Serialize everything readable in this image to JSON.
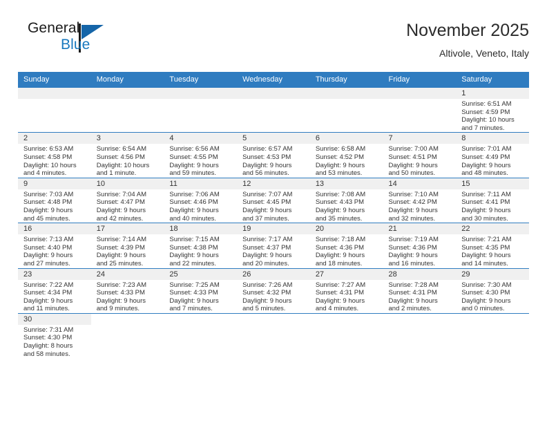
{
  "brand": {
    "name_part1": "General",
    "name_part2": "Blue"
  },
  "header": {
    "title": "November 2025",
    "location": "Altivole, Veneto, Italy"
  },
  "weekdays": [
    "Sunday",
    "Monday",
    "Tuesday",
    "Wednesday",
    "Thursday",
    "Friday",
    "Saturday"
  ],
  "colors": {
    "header_blue": "#2f7cc0",
    "brand_blue": "#1878be",
    "daynum_band": "#f0f0f0",
    "text": "#333333"
  },
  "weeks": [
    [
      {
        "type": "blank"
      },
      {
        "type": "blank"
      },
      {
        "type": "blank"
      },
      {
        "type": "blank"
      },
      {
        "type": "blank"
      },
      {
        "type": "blank"
      },
      {
        "type": "day",
        "day": "1",
        "sunrise": "Sunrise: 6:51 AM",
        "sunset": "Sunset: 4:59 PM",
        "daylight1": "Daylight: 10 hours",
        "daylight2": "and 7 minutes."
      }
    ],
    [
      {
        "type": "day",
        "day": "2",
        "sunrise": "Sunrise: 6:53 AM",
        "sunset": "Sunset: 4:58 PM",
        "daylight1": "Daylight: 10 hours",
        "daylight2": "and 4 minutes."
      },
      {
        "type": "day",
        "day": "3",
        "sunrise": "Sunrise: 6:54 AM",
        "sunset": "Sunset: 4:56 PM",
        "daylight1": "Daylight: 10 hours",
        "daylight2": "and 1 minute."
      },
      {
        "type": "day",
        "day": "4",
        "sunrise": "Sunrise: 6:56 AM",
        "sunset": "Sunset: 4:55 PM",
        "daylight1": "Daylight: 9 hours",
        "daylight2": "and 59 minutes."
      },
      {
        "type": "day",
        "day": "5",
        "sunrise": "Sunrise: 6:57 AM",
        "sunset": "Sunset: 4:53 PM",
        "daylight1": "Daylight: 9 hours",
        "daylight2": "and 56 minutes."
      },
      {
        "type": "day",
        "day": "6",
        "sunrise": "Sunrise: 6:58 AM",
        "sunset": "Sunset: 4:52 PM",
        "daylight1": "Daylight: 9 hours",
        "daylight2": "and 53 minutes."
      },
      {
        "type": "day",
        "day": "7",
        "sunrise": "Sunrise: 7:00 AM",
        "sunset": "Sunset: 4:51 PM",
        "daylight1": "Daylight: 9 hours",
        "daylight2": "and 50 minutes."
      },
      {
        "type": "day",
        "day": "8",
        "sunrise": "Sunrise: 7:01 AM",
        "sunset": "Sunset: 4:49 PM",
        "daylight1": "Daylight: 9 hours",
        "daylight2": "and 48 minutes."
      }
    ],
    [
      {
        "type": "day",
        "day": "9",
        "sunrise": "Sunrise: 7:03 AM",
        "sunset": "Sunset: 4:48 PM",
        "daylight1": "Daylight: 9 hours",
        "daylight2": "and 45 minutes."
      },
      {
        "type": "day",
        "day": "10",
        "sunrise": "Sunrise: 7:04 AM",
        "sunset": "Sunset: 4:47 PM",
        "daylight1": "Daylight: 9 hours",
        "daylight2": "and 42 minutes."
      },
      {
        "type": "day",
        "day": "11",
        "sunrise": "Sunrise: 7:06 AM",
        "sunset": "Sunset: 4:46 PM",
        "daylight1": "Daylight: 9 hours",
        "daylight2": "and 40 minutes."
      },
      {
        "type": "day",
        "day": "12",
        "sunrise": "Sunrise: 7:07 AM",
        "sunset": "Sunset: 4:45 PM",
        "daylight1": "Daylight: 9 hours",
        "daylight2": "and 37 minutes."
      },
      {
        "type": "day",
        "day": "13",
        "sunrise": "Sunrise: 7:08 AM",
        "sunset": "Sunset: 4:43 PM",
        "daylight1": "Daylight: 9 hours",
        "daylight2": "and 35 minutes."
      },
      {
        "type": "day",
        "day": "14",
        "sunrise": "Sunrise: 7:10 AM",
        "sunset": "Sunset: 4:42 PM",
        "daylight1": "Daylight: 9 hours",
        "daylight2": "and 32 minutes."
      },
      {
        "type": "day",
        "day": "15",
        "sunrise": "Sunrise: 7:11 AM",
        "sunset": "Sunset: 4:41 PM",
        "daylight1": "Daylight: 9 hours",
        "daylight2": "and 30 minutes."
      }
    ],
    [
      {
        "type": "day",
        "day": "16",
        "sunrise": "Sunrise: 7:13 AM",
        "sunset": "Sunset: 4:40 PM",
        "daylight1": "Daylight: 9 hours",
        "daylight2": "and 27 minutes."
      },
      {
        "type": "day",
        "day": "17",
        "sunrise": "Sunrise: 7:14 AM",
        "sunset": "Sunset: 4:39 PM",
        "daylight1": "Daylight: 9 hours",
        "daylight2": "and 25 minutes."
      },
      {
        "type": "day",
        "day": "18",
        "sunrise": "Sunrise: 7:15 AM",
        "sunset": "Sunset: 4:38 PM",
        "daylight1": "Daylight: 9 hours",
        "daylight2": "and 22 minutes."
      },
      {
        "type": "day",
        "day": "19",
        "sunrise": "Sunrise: 7:17 AM",
        "sunset": "Sunset: 4:37 PM",
        "daylight1": "Daylight: 9 hours",
        "daylight2": "and 20 minutes."
      },
      {
        "type": "day",
        "day": "20",
        "sunrise": "Sunrise: 7:18 AM",
        "sunset": "Sunset: 4:36 PM",
        "daylight1": "Daylight: 9 hours",
        "daylight2": "and 18 minutes."
      },
      {
        "type": "day",
        "day": "21",
        "sunrise": "Sunrise: 7:19 AM",
        "sunset": "Sunset: 4:36 PM",
        "daylight1": "Daylight: 9 hours",
        "daylight2": "and 16 minutes."
      },
      {
        "type": "day",
        "day": "22",
        "sunrise": "Sunrise: 7:21 AM",
        "sunset": "Sunset: 4:35 PM",
        "daylight1": "Daylight: 9 hours",
        "daylight2": "and 14 minutes."
      }
    ],
    [
      {
        "type": "day",
        "day": "23",
        "sunrise": "Sunrise: 7:22 AM",
        "sunset": "Sunset: 4:34 PM",
        "daylight1": "Daylight: 9 hours",
        "daylight2": "and 11 minutes."
      },
      {
        "type": "day",
        "day": "24",
        "sunrise": "Sunrise: 7:23 AM",
        "sunset": "Sunset: 4:33 PM",
        "daylight1": "Daylight: 9 hours",
        "daylight2": "and 9 minutes."
      },
      {
        "type": "day",
        "day": "25",
        "sunrise": "Sunrise: 7:25 AM",
        "sunset": "Sunset: 4:33 PM",
        "daylight1": "Daylight: 9 hours",
        "daylight2": "and 7 minutes."
      },
      {
        "type": "day",
        "day": "26",
        "sunrise": "Sunrise: 7:26 AM",
        "sunset": "Sunset: 4:32 PM",
        "daylight1": "Daylight: 9 hours",
        "daylight2": "and 5 minutes."
      },
      {
        "type": "day",
        "day": "27",
        "sunrise": "Sunrise: 7:27 AM",
        "sunset": "Sunset: 4:31 PM",
        "daylight1": "Daylight: 9 hours",
        "daylight2": "and 4 minutes."
      },
      {
        "type": "day",
        "day": "28",
        "sunrise": "Sunrise: 7:28 AM",
        "sunset": "Sunset: 4:31 PM",
        "daylight1": "Daylight: 9 hours",
        "daylight2": "and 2 minutes."
      },
      {
        "type": "day",
        "day": "29",
        "sunrise": "Sunrise: 7:30 AM",
        "sunset": "Sunset: 4:30 PM",
        "daylight1": "Daylight: 9 hours",
        "daylight2": "and 0 minutes."
      }
    ],
    [
      {
        "type": "day",
        "day": "30",
        "sunrise": "Sunrise: 7:31 AM",
        "sunset": "Sunset: 4:30 PM",
        "daylight1": "Daylight: 8 hours",
        "daylight2": "and 58 minutes."
      },
      {
        "type": "blank"
      },
      {
        "type": "blank"
      },
      {
        "type": "blank"
      },
      {
        "type": "blank"
      },
      {
        "type": "blank"
      },
      {
        "type": "blank"
      }
    ]
  ]
}
